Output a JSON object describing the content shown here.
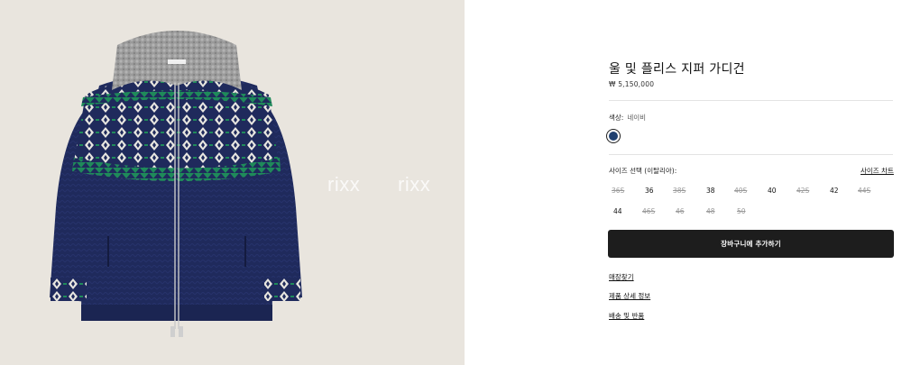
{
  "product": {
    "image": {
      "icon": "product-photo-navy-fair-isle-zip-cardigan",
      "background": "#e9e5de",
      "body_color": "#1f2a5c",
      "pattern_green": "#1f8a5a",
      "collar_color": "#9b9b9b",
      "watermark_1": "rixx",
      "watermark_2": "rixx"
    },
    "title": "울 및 플리스 지퍼 가디건",
    "price": "₩ 5,150,000"
  },
  "color": {
    "label": "색상:",
    "selected": "네이비",
    "swatch_hex": "#1f4070"
  },
  "size": {
    "label": "사이즈 선택 (이탈리아):",
    "chart_link": "사이즈 차트",
    "rows": [
      [
        {
          "label": "36S",
          "available": false
        },
        {
          "label": "36",
          "available": true
        },
        {
          "label": "38S",
          "available": false
        },
        {
          "label": "38",
          "available": true
        },
        {
          "label": "40S",
          "available": false
        },
        {
          "label": "40",
          "available": true
        },
        {
          "label": "42S",
          "available": false
        },
        {
          "label": "42",
          "available": true
        },
        {
          "label": "44S",
          "available": false
        }
      ],
      [
        {
          "label": "44",
          "available": true
        },
        {
          "label": "46S",
          "available": false
        },
        {
          "label": "46",
          "available": false
        },
        {
          "label": "48",
          "available": false
        },
        {
          "label": "50",
          "available": false
        }
      ]
    ]
  },
  "cart_button": "장바구니에 추가하기",
  "links": {
    "store": "매장찾기",
    "details": "제품 상세 정보",
    "shipping": "배송 및 반품"
  }
}
